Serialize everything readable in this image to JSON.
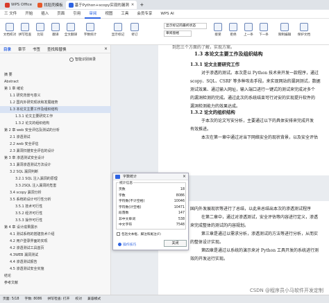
{
  "titlebar": {
    "tabs": [
      {
        "label": "WPS Office",
        "color": "#d83b2b"
      },
      {
        "label": "找稻壳模板",
        "color": "#e6592b"
      },
      {
        "label": "基于Python+scopy实现的漏洞",
        "color": "#2d63e2"
      }
    ]
  },
  "menubar": {
    "items": [
      "三 文件",
      "开始",
      "插入",
      "页面",
      "引用",
      "审阅",
      "视图",
      "工具",
      "会员专享",
      "WPS AI"
    ],
    "active_index": 5
  },
  "ribbon": {
    "buttons": [
      "文档校对",
      "拼写检查",
      "比较",
      "翻译",
      "全文翻译",
      "字数统计",
      "显示标记",
      "修订",
      "接受",
      "拒绝",
      "上一条",
      "下一条",
      "限制编辑",
      "保护文档"
    ],
    "dropdown": "显示标记的最终状态",
    "reviewer": "审阅窗格"
  },
  "sidebar": {
    "tabs": [
      "目录",
      "章节",
      "书签",
      "查找和替换"
    ],
    "smart_button": "智能识别目录",
    "outline": [
      {
        "label": "摘 要",
        "level": 1
      },
      {
        "label": "Abstract",
        "level": 1
      },
      {
        "label": "第 1 章 绪论",
        "level": 1
      },
      {
        "label": "1.1 研究背景与意义",
        "level": 2
      },
      {
        "label": "1.2 国内外研究现状和发展趋势",
        "level": 2
      },
      {
        "label": "1.3 本论文主要工作及组织结构",
        "level": 2,
        "selected": true
      },
      {
        "label": "1.3.1 论文主要研究工作",
        "level": 3
      },
      {
        "label": "1.3.2 论文的组织结构",
        "level": 3
      },
      {
        "label": "第 2 章 web 安全评估及测试的分析",
        "level": 1
      },
      {
        "label": "2.1 渗透测试",
        "level": 2
      },
      {
        "label": "2.2 web 安全评估",
        "level": 2
      },
      {
        "label": "2.3 漏洞扫描安全评估的设计",
        "level": 2
      },
      {
        "label": "第 3 章 渗透测试安全设计",
        "level": 1
      },
      {
        "label": "3.1 漏洞渗透测试方法设计",
        "level": 2
      },
      {
        "label": "3.2 SQL 漏洞判断",
        "level": 2
      },
      {
        "label": "3.2.1 SQL 注入漏洞的原理",
        "level": 3
      },
      {
        "label": "3.3.2SQL 注入漏洞的危害",
        "level": 3
      },
      {
        "label": "3.4 scopy 漏洞分析",
        "level": 2
      },
      {
        "label": "3.5 系统的设计可行性分析",
        "level": 2
      },
      {
        "label": "3.5.1 技术可行性",
        "level": 3
      },
      {
        "label": "3.5.2 经济可行性",
        "level": 3
      },
      {
        "label": "3.5.3 操作可行性",
        "level": 3
      },
      {
        "label": "第 4 章 设计成果展示",
        "level": 1
      },
      {
        "label": "4.1 测试系统的搭建技术介绍",
        "level": 2
      },
      {
        "label": "4.2 用户登录界面的实现",
        "level": 2
      },
      {
        "label": "4.2 渗透测试工具首页",
        "level": 2
      },
      {
        "label": "4.3WEB 漏洞测试",
        "level": 2
      },
      {
        "label": "4.4 渗透测试报告",
        "level": 2
      },
      {
        "label": "4.5 渗透测试安全实施",
        "level": 2
      },
      {
        "label": "结论",
        "level": 1
      },
      {
        "label": "参考文献",
        "level": 1
      }
    ]
  },
  "document": {
    "top_line": "到您三个方面的了解，实现方案。",
    "heading": "1.3  本论文主要工作及组织结构",
    "sub1": "1.3.1  论文主要研究工作",
    "para1": [
      "对于渗透的测试。本次是以 Python 技术来开发一款程序，通过",
      "scopy、SQL、CSRF 等多种攻击手段。来实现网站的漏洞测试，数据",
      "测试效果、通过输入网址，输入端口进行一键式的测试来完成对多个",
      "的漏洞检测的完成。通过此次的系统结束可行对安的实现提升软件的",
      "漏洞检测能力的效果达成。"
    ],
    "sub2": "1.3.2  论文的组织结构",
    "para2": [
      "于本次的论文写安分析，主要通过以下的具体安排来完成开发",
      "有效推进。",
      "本次在第一章中通过对当下网络安全的现状背景，以及安全评估"
    ],
    "page2": [
      "国内外发展现状等进行了总结，以此来总结出本次的渗透测试程序",
      "在第二章中，通过对渗透测试，安全评估等内容进行定义，渗透",
      "来完成整体的测试的内容规划。",
      "第三章是通过以需求分析，渗透测试的方法等进行分析，从而实",
      "的整体设计实现。",
      "第四章是通过以系统的演示来对 Python 工具开发的系统进行测",
      "效的开发运行实现。"
    ]
  },
  "dialog": {
    "title": "字数统计",
    "group_label": "统计信息",
    "stats": [
      {
        "label": "页数",
        "value": "18"
      },
      {
        "label": "字数",
        "value": "8086"
      },
      {
        "label": "字符数(不计空格)",
        "value": "10046"
      },
      {
        "label": "字符数(计空格)",
        "value": "10471"
      },
      {
        "label": "段落数",
        "value": "147"
      },
      {
        "label": "非中文单词",
        "value": "538"
      },
      {
        "label": "中文字符",
        "value": "7548"
      }
    ],
    "checkbox": "包括文本框、脚注和尾注(F)",
    "link": "操作技巧",
    "close": "关闭"
  },
  "statusbar": {
    "items": [
      "页面: 5/18",
      "字数: 8086",
      "拼写检查: 打开",
      "校对",
      "兼容模式"
    ]
  },
  "watermark": "CSDN @程序员小马软件开发定制"
}
